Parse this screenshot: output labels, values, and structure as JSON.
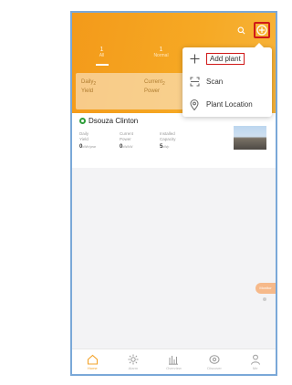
{
  "header": {
    "tabs": [
      {
        "count": "1",
        "label": "All"
      },
      {
        "count": "1",
        "label": "Normal"
      }
    ],
    "stats": [
      {
        "label1": "Daily",
        "label2": "Yield",
        "sub": "2"
      },
      {
        "label1": "Current",
        "label2": "Power",
        "sub": "2"
      }
    ],
    "icons": [
      "search-icon",
      "add-circle-icon"
    ]
  },
  "plant": {
    "name": "Dsouza Clinton",
    "metrics": [
      {
        "label1": "Daily",
        "label2": "Yield",
        "value": "0",
        "unit": "kWh/year"
      },
      {
        "label1": "Current",
        "label2": "Power",
        "value": "0",
        "unit": "kW/kW"
      },
      {
        "label1": "Installed",
        "label2": "Capacity",
        "value": "5",
        "unit": "kWp"
      }
    ]
  },
  "menu": {
    "items": [
      {
        "label": "Add plant",
        "icon": "plus-icon"
      },
      {
        "label": "Scan",
        "icon": "scan-icon"
      },
      {
        "label": "Plant Location",
        "icon": "location-pin-icon"
      }
    ]
  },
  "float": {
    "label": "Monitor"
  },
  "nav": {
    "items": [
      {
        "label": "Home",
        "icon": "home-icon",
        "active": true
      },
      {
        "label": "Alarm",
        "icon": "sun-icon"
      },
      {
        "label": "Overview",
        "icon": "bar-chart-icon"
      },
      {
        "label": "Discover",
        "icon": "eye-icon"
      },
      {
        "label": "Me",
        "icon": "person-icon"
      }
    ]
  },
  "colors": {
    "accent": "#f39a1a",
    "highlight": "#d01818",
    "active_nav": "#f3a32a"
  }
}
